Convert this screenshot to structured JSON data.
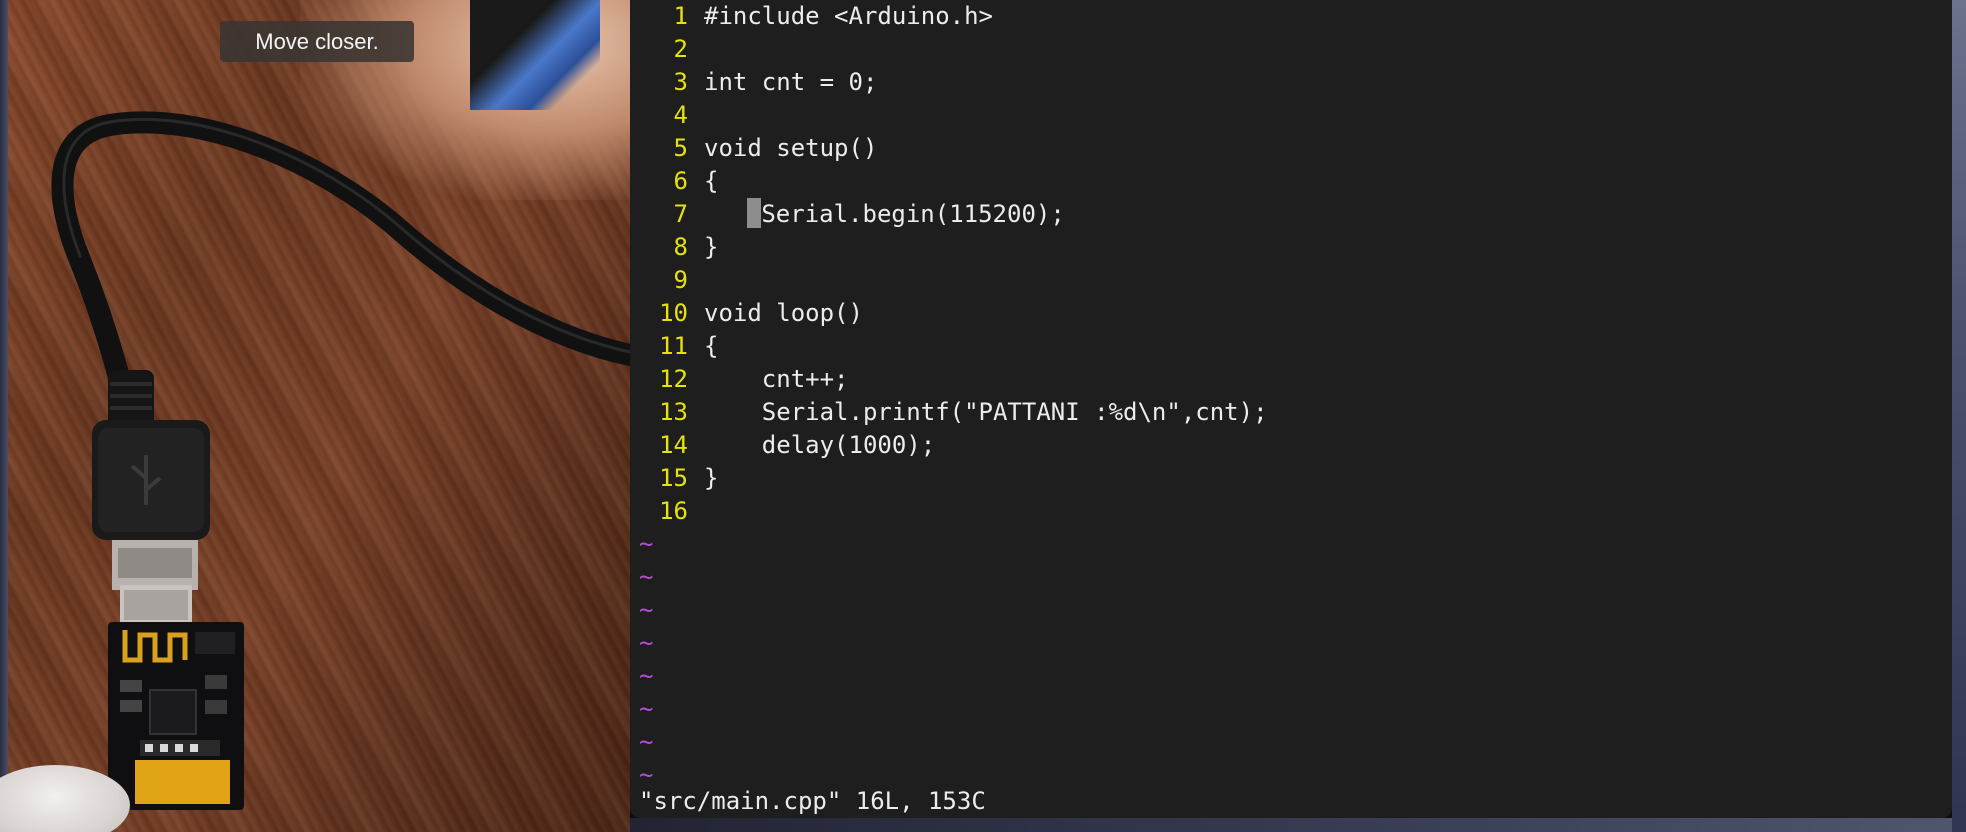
{
  "camera": {
    "hint": "Move closer."
  },
  "editor": {
    "lines": [
      {
        "n": "1",
        "text": "#include <Arduino.h>"
      },
      {
        "n": "2",
        "text": ""
      },
      {
        "n": "3",
        "text": "int cnt = 0;"
      },
      {
        "n": "4",
        "text": ""
      },
      {
        "n": "5",
        "text": "void setup()"
      },
      {
        "n": "6",
        "text": "{"
      },
      {
        "n": "7",
        "text": "    Serial.begin(115200);"
      },
      {
        "n": "8",
        "text": "}"
      },
      {
        "n": "9",
        "text": ""
      },
      {
        "n": "10",
        "text": "void loop()"
      },
      {
        "n": "11",
        "text": "{"
      },
      {
        "n": "12",
        "text": "    cnt++;"
      },
      {
        "n": "13",
        "text": "    Serial.printf(\"PATTANI :%d\\n\",cnt);"
      },
      {
        "n": "14",
        "text": "    delay(1000);"
      },
      {
        "n": "15",
        "text": "}"
      },
      {
        "n": "16",
        "text": ""
      }
    ],
    "cursor_line": 7,
    "empty_line_marker": "~",
    "empty_line_count": 8,
    "status": "\"src/main.cpp\" 16L, 153C"
  },
  "colors": {
    "editor_bg": "#1e1e1e",
    "line_number": "#e5e20e",
    "tilde": "#b24fd6",
    "text": "#ececec"
  }
}
